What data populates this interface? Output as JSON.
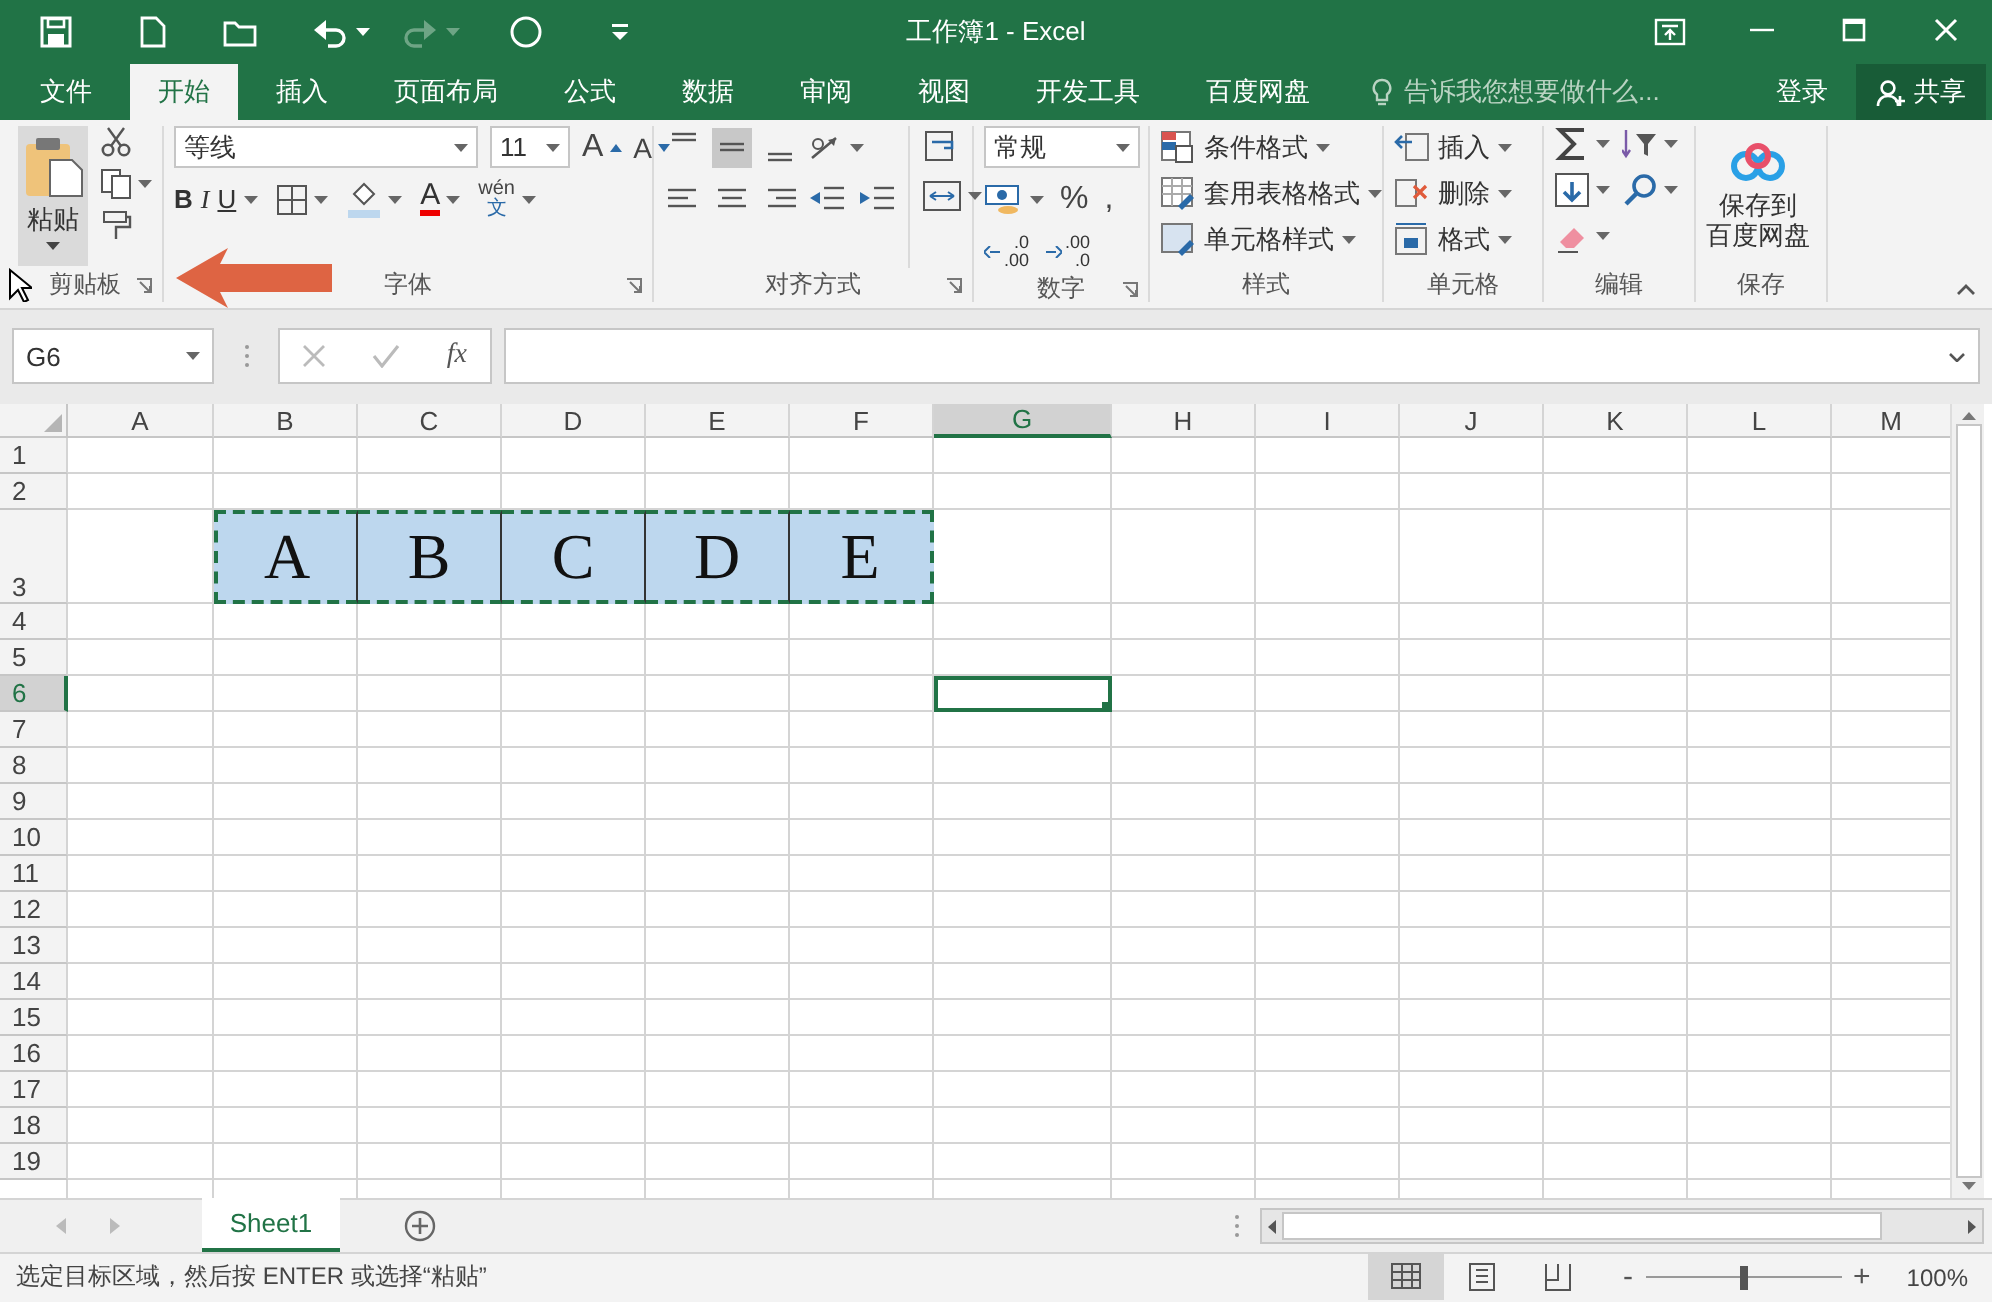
{
  "window": {
    "title": "工作簿1 - Excel"
  },
  "tabs": [
    {
      "label": "文件",
      "selected": false
    },
    {
      "label": "开始",
      "selected": true
    },
    {
      "label": "插入",
      "selected": false
    },
    {
      "label": "页面布局",
      "selected": false
    },
    {
      "label": "公式",
      "selected": false
    },
    {
      "label": "数据",
      "selected": false
    },
    {
      "label": "审阅",
      "selected": false
    },
    {
      "label": "视图",
      "selected": false
    },
    {
      "label": "开发工具",
      "selected": false
    },
    {
      "label": "百度网盘",
      "selected": false
    }
  ],
  "tell_me": {
    "placeholder": "告诉我您想要做什么..."
  },
  "sign_in": "登录",
  "share": "共享",
  "ribbon": {
    "clipboard": {
      "label": "剪贴板",
      "paste": "粘贴"
    },
    "font": {
      "label": "字体",
      "font_name": "等线",
      "font_size": "11",
      "grow": "A",
      "shrink": "A",
      "bold": "B",
      "italic": "I",
      "underline": "U",
      "font_color": "A",
      "phonetic": [
        "wén",
        "文"
      ]
    },
    "alignment": {
      "label": "对齐方式",
      "vertical_align": [
        {
          "selected": false
        },
        {
          "selected": true
        },
        {
          "selected": false
        }
      ]
    },
    "number": {
      "label": "数字",
      "format": "常规",
      "percent": "%",
      "comma": ",",
      "decimals": [
        {
          "lines": [
            ".0",
            ".00"
          ]
        },
        {
          "lines": [
            ".00",
            ".0"
          ]
        }
      ]
    },
    "styles": {
      "label": "样式",
      "items": [
        "条件格式",
        "套用表格格式",
        "单元格样式"
      ]
    },
    "cells": {
      "label": "单元格",
      "items": [
        "插入",
        "删除",
        "格式"
      ]
    },
    "editing": {
      "label": "编辑"
    },
    "save": {
      "label": "保存",
      "button": [
        "保存到",
        "百度网盘"
      ]
    }
  },
  "formula_bar": {
    "name_box": "G6",
    "function": "fx"
  },
  "sheet": {
    "columns": [
      {
        "label": "A",
        "selected": false
      },
      {
        "label": "B",
        "selected": false
      },
      {
        "label": "C",
        "selected": false
      },
      {
        "label": "D",
        "selected": false
      },
      {
        "label": "E",
        "selected": false
      },
      {
        "label": "F",
        "selected": false
      },
      {
        "label": "G",
        "selected": true
      },
      {
        "label": "H",
        "selected": false
      },
      {
        "label": "I",
        "selected": false
      },
      {
        "label": "J",
        "selected": false
      },
      {
        "label": "K",
        "selected": false
      },
      {
        "label": "L",
        "selected": false
      },
      {
        "label": "M",
        "selected": false
      }
    ],
    "rows": [
      {
        "label": "1",
        "selected": false
      },
      {
        "label": "2",
        "selected": false
      },
      {
        "label": "3",
        "selected": false,
        "cells": [
          null,
          {
            "value": "A",
            "copied": true
          },
          {
            "value": "B",
            "copied": true
          },
          {
            "value": "C",
            "copied": true
          },
          {
            "value": "D",
            "copied": true
          },
          {
            "value": "E",
            "copied": true
          }
        ]
      },
      {
        "label": "4",
        "selected": false
      },
      {
        "label": "5",
        "selected": false
      },
      {
        "label": "6",
        "selected": true
      },
      {
        "label": "7",
        "selected": false
      },
      {
        "label": "8",
        "selected": false
      },
      {
        "label": "9",
        "selected": false
      },
      {
        "label": "10",
        "selected": false
      },
      {
        "label": "11",
        "selected": false
      },
      {
        "label": "12",
        "selected": false
      },
      {
        "label": "13",
        "selected": false
      },
      {
        "label": "14",
        "selected": false
      },
      {
        "label": "15",
        "selected": false
      },
      {
        "label": "16",
        "selected": false
      },
      {
        "label": "17",
        "selected": false
      },
      {
        "label": "18",
        "selected": false
      },
      {
        "label": "19",
        "selected": false
      }
    ]
  },
  "sheet_tabs": [
    {
      "label": "Sheet1",
      "selected": true
    }
  ],
  "status_bar": {
    "message": "选定目标区域，然后按 ENTER 或选择“粘贴”",
    "views": [
      {
        "selected": true
      },
      {
        "selected": false
      },
      {
        "selected": false
      }
    ],
    "zoom_out": "-",
    "zoom_slider": {
      "level": 0.5
    },
    "zoom_in": "+",
    "zoom": "100%"
  }
}
